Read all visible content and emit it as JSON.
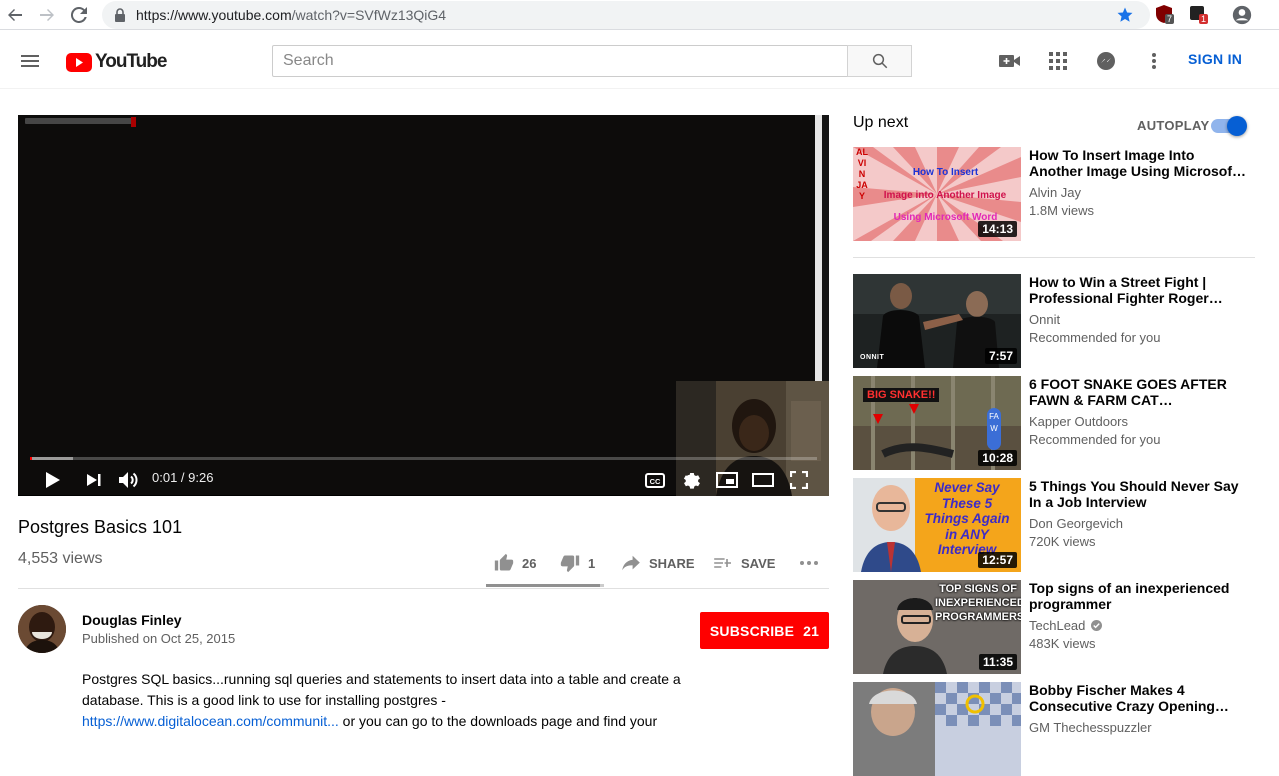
{
  "browser": {
    "url_host": "https://www.youtube.com",
    "url_path": "/watch?v=SVfWz13QiG4",
    "ext_badge_1": "7",
    "ext_badge_2": "1"
  },
  "header": {
    "logo_text": "YouTube",
    "search_placeholder": "Search",
    "sign_in": "SIGN IN"
  },
  "player": {
    "time": "0:01 / 9:26",
    "progress_fraction": 0.002
  },
  "video": {
    "title": "Postgres Basics 101",
    "views": "4,553 views",
    "likes": "26",
    "dislikes": "1",
    "share_label": "SHARE",
    "save_label": "SAVE",
    "like_ratio": 0.963
  },
  "channel": {
    "name": "Douglas Finley",
    "published": "Published on Oct 25, 2015",
    "subscribe_label": "SUBSCRIBE",
    "subscriber_count": "21"
  },
  "description": {
    "line1": "Postgres SQL basics...running sql queries and statements to insert data into a table and create a",
    "line2": "database.  This is a good link to use for installing postgres -",
    "link": "https://www.digitalocean.com/communit...",
    "line3_rest": " or you can go to the downloads page and find your"
  },
  "upnext": {
    "title": "Up next",
    "autoplay_label": "AUTOPLAY",
    "autoplay_on": true,
    "items": [
      {
        "title_line1": "How To Insert Image Into",
        "title_line2": "Another Image Using Microsof…",
        "channel": "Alvin Jay",
        "meta": "1.8M views",
        "duration": "14:13",
        "thumb_text_1": "How To Insert",
        "thumb_text_2": "Image into Another Image",
        "thumb_text_3": "Using Microsoft Word",
        "thumb_side": "ALVIN JAY"
      },
      {
        "title_line1": "How to Win a Street Fight |",
        "title_line2": "Professional Fighter Roger…",
        "channel": "Onnit",
        "meta": "Recommended for you",
        "duration": "7:57",
        "thumb_logo": "ONNIT"
      },
      {
        "title_line1": "6 FOOT SNAKE GOES AFTER",
        "title_line2": "FAWN & FARM CAT…",
        "channel": "Kapper Outdoors",
        "meta": "Recommended for you",
        "duration": "10:28",
        "thumb_text": "BIG SNAKE!!",
        "thumb_side": "FAW"
      },
      {
        "title_line1": "5 Things You Should Never Say",
        "title_line2": "In a Job Interview",
        "channel": "Don Georgevich",
        "meta": "720K views",
        "duration": "12:57",
        "thumb_text_1": "Never Say",
        "thumb_text_2": "These 5",
        "thumb_text_3": "Things Again",
        "thumb_text_4": "in ANY",
        "thumb_text_5": "Interview"
      },
      {
        "title_line1": "Top signs of an inexperienced",
        "title_line2": "programmer",
        "channel": "TechLead",
        "meta": "483K views",
        "duration": "11:35",
        "verified": true,
        "thumb_text_1": "TOP SIGNS OF",
        "thumb_text_2": "INEXPERIENCED",
        "thumb_text_3": "PROGRAMMERS"
      },
      {
        "title_line1": "Bobby Fischer Makes 4",
        "title_line2": "Consecutive Crazy Opening…",
        "channel": "GM Thechesspuzzler",
        "meta": ""
      }
    ]
  },
  "colors": {
    "brand_red": "#ff0000",
    "link_blue": "#065fd4",
    "secondary_text": "#606060"
  }
}
